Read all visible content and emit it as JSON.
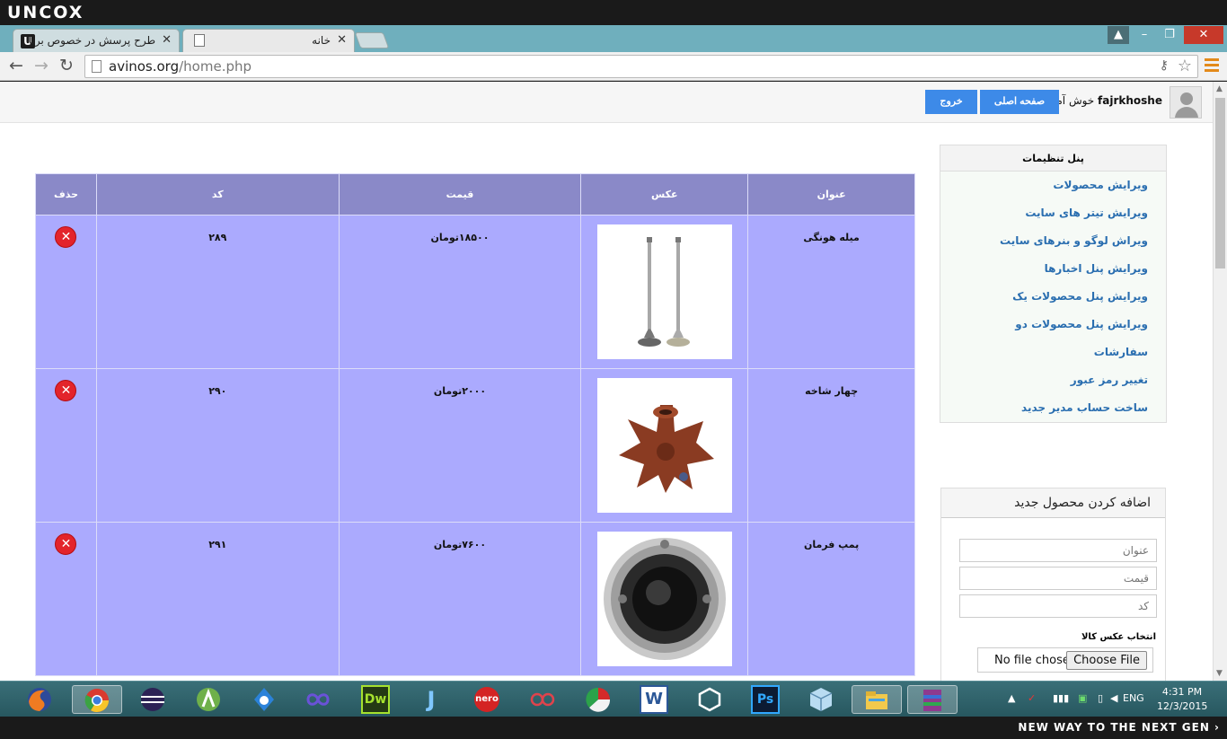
{
  "os": {
    "brand": "UNCOX",
    "slogan": "NEW WAY TO THE NEXT GEN ›"
  },
  "browser": {
    "tabs": [
      {
        "title": "طرح پرسش در خصوص برنا",
        "icon": "uncox-icon",
        "active": false
      },
      {
        "title": "خانه",
        "icon": "page-icon",
        "active": true
      }
    ],
    "close_glyph": "✕",
    "url_host": "avinos.org",
    "url_path": "/home.php"
  },
  "header": {
    "username": "fajrkhoshe",
    "welcome_text": "خوش آمدید",
    "home_button": "صفحه اصلی",
    "logout_button": "خروج"
  },
  "settings_panel": {
    "title": "پنل تنظیمات",
    "items": [
      "ویرایش محصولات",
      "ویرایش تیتر های سایت",
      "ویراش لوگو و بنرهای سایت",
      "ویرایش پنل اخبارها",
      "ویرایش پنل محصولات یک",
      "ویرایش پنل محصولات دو",
      "سفارشات",
      "تغییر رمز عبور",
      "ساخت حساب مدیر جدید"
    ]
  },
  "add_product": {
    "title": "اضافه کردن محصول جدید",
    "title_placeholder": "عنوان",
    "price_placeholder": "قیمت",
    "code_placeholder": "کد",
    "image_label": "انتخاب عکس کالا",
    "no_file": "No file chosen",
    "choose_file": "Choose File"
  },
  "products_table": {
    "headers": {
      "title": "عنوان",
      "image": "عکس",
      "price": "قیمت",
      "code": "کد",
      "delete": "حذف"
    },
    "rows": [
      {
        "title": "میله هونگی",
        "price": "۱۸۵۰۰تومان",
        "code": "۲۸۹",
        "image": "valves"
      },
      {
        "title": "چهار شاخه",
        "price": "۲۰۰۰تومان",
        "code": "۲۹۰",
        "image": "spider"
      },
      {
        "title": "پمپ فرمان",
        "price": "۷۶۰۰تومان",
        "code": "۲۹۱",
        "image": "hub"
      }
    ],
    "delete_glyph": "✕"
  },
  "taskbar": {
    "apps": [
      "firefox-icon",
      "chrome-icon",
      "eclipse-icon",
      "android-studio-icon",
      "app-drop-icon",
      "infinity-icon",
      "dreamweaver-icon",
      "ji-icon",
      "nero-icon",
      "glasses-icon",
      "pie-icon",
      "word-icon",
      "unity-icon",
      "photoshop-icon",
      "box-icon",
      "explorer-icon",
      "winrar-icon"
    ],
    "dw_label": "Dw",
    "ps_label": "Ps",
    "w_label": "W",
    "nero_label": "nero",
    "lang": "ENG",
    "time": "4:31 PM",
    "date": "12/3/2015"
  }
}
